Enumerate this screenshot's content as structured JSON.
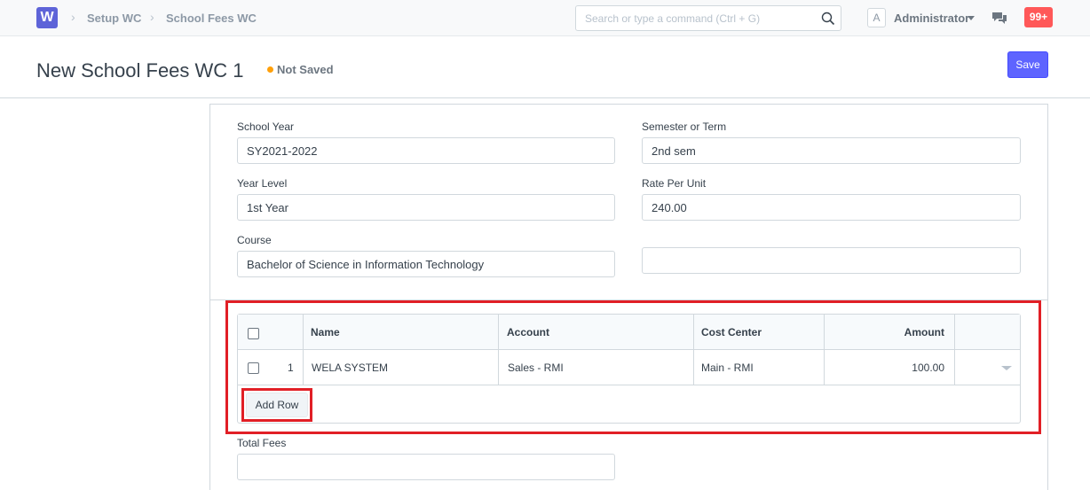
{
  "navbar": {
    "logo_letter": "W",
    "breadcrumbs": [
      "Setup WC",
      "School Fees WC"
    ],
    "search_placeholder": "Search or type a command (Ctrl + G)",
    "avatar_letter": "A",
    "user_name": "Administrator",
    "notification_count": "99+"
  },
  "page": {
    "title": "New School Fees WC 1",
    "status": "Not Saved",
    "save_label": "Save"
  },
  "form": {
    "school_year_label": "School Year",
    "school_year_value": "SY2021-2022",
    "semester_label": "Semester or Term",
    "semester_value": "2nd sem",
    "year_level_label": "Year Level",
    "year_level_value": "1st Year",
    "rate_label": "Rate Per Unit",
    "rate_value": "240.00",
    "course_label": "Course",
    "course_value": "Bachelor of Science in Information Technology",
    "extra_value": "",
    "total_fees_label": "Total Fees",
    "total_fees_value": ""
  },
  "table": {
    "columns": [
      "Name",
      "Account",
      "Cost Center",
      "Amount"
    ],
    "rows": [
      {
        "idx": "1",
        "name": "WELA SYSTEM",
        "account": "Sales - RMI",
        "cost_center": "Main - RMI",
        "amount": "100.00"
      }
    ],
    "add_row_label": "Add Row"
  },
  "colors": {
    "primary": "#5e64ff",
    "highlight": "#e11f26",
    "status_dot": "#ffa00a",
    "badge": "#ff5858"
  }
}
